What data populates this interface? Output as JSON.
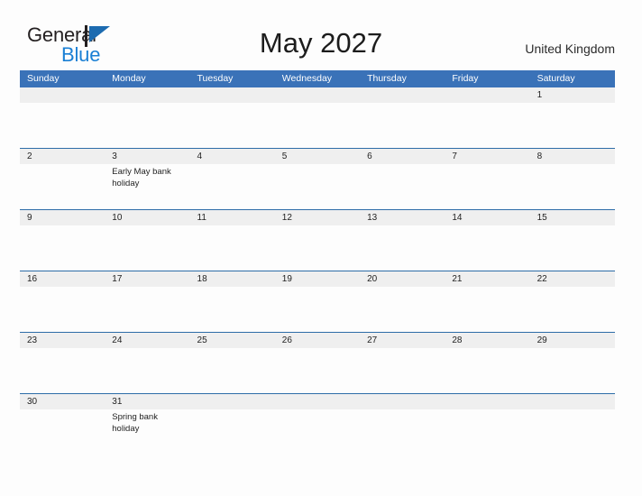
{
  "brand": {
    "name_part1": "General",
    "name_part2": "Blue",
    "flag_icon": "flag-triangle-icon",
    "color_dark": "#231f20",
    "color_blue": "#1a7fd4"
  },
  "header": {
    "month_title": "May 2027",
    "country": "United Kingdom"
  },
  "theme": {
    "header_blue": "#3a72b8",
    "rule_blue": "#2e6da8",
    "date_band_gray": "#efefef",
    "page_background": "#fdfdfd"
  },
  "calendar": {
    "weekdays": [
      "Sunday",
      "Monday",
      "Tuesday",
      "Wednesday",
      "Thursday",
      "Friday",
      "Saturday"
    ],
    "weeks": [
      {
        "top_rule": false,
        "days": [
          {
            "date": "",
            "event": ""
          },
          {
            "date": "",
            "event": ""
          },
          {
            "date": "",
            "event": ""
          },
          {
            "date": "",
            "event": ""
          },
          {
            "date": "",
            "event": ""
          },
          {
            "date": "",
            "event": ""
          },
          {
            "date": "1",
            "event": ""
          }
        ]
      },
      {
        "top_rule": true,
        "days": [
          {
            "date": "2",
            "event": ""
          },
          {
            "date": "3",
            "event": "Early May bank holiday"
          },
          {
            "date": "4",
            "event": ""
          },
          {
            "date": "5",
            "event": ""
          },
          {
            "date": "6",
            "event": ""
          },
          {
            "date": "7",
            "event": ""
          },
          {
            "date": "8",
            "event": ""
          }
        ]
      },
      {
        "top_rule": true,
        "days": [
          {
            "date": "9",
            "event": ""
          },
          {
            "date": "10",
            "event": ""
          },
          {
            "date": "11",
            "event": ""
          },
          {
            "date": "12",
            "event": ""
          },
          {
            "date": "13",
            "event": ""
          },
          {
            "date": "14",
            "event": ""
          },
          {
            "date": "15",
            "event": ""
          }
        ]
      },
      {
        "top_rule": true,
        "days": [
          {
            "date": "16",
            "event": ""
          },
          {
            "date": "17",
            "event": ""
          },
          {
            "date": "18",
            "event": ""
          },
          {
            "date": "19",
            "event": ""
          },
          {
            "date": "20",
            "event": ""
          },
          {
            "date": "21",
            "event": ""
          },
          {
            "date": "22",
            "event": ""
          }
        ]
      },
      {
        "top_rule": true,
        "days": [
          {
            "date": "23",
            "event": ""
          },
          {
            "date": "24",
            "event": ""
          },
          {
            "date": "25",
            "event": ""
          },
          {
            "date": "26",
            "event": ""
          },
          {
            "date": "27",
            "event": ""
          },
          {
            "date": "28",
            "event": ""
          },
          {
            "date": "29",
            "event": ""
          }
        ]
      },
      {
        "top_rule": true,
        "days": [
          {
            "date": "30",
            "event": ""
          },
          {
            "date": "31",
            "event": "Spring bank holiday"
          },
          {
            "date": "",
            "event": ""
          },
          {
            "date": "",
            "event": ""
          },
          {
            "date": "",
            "event": ""
          },
          {
            "date": "",
            "event": ""
          },
          {
            "date": "",
            "event": ""
          }
        ]
      }
    ]
  }
}
